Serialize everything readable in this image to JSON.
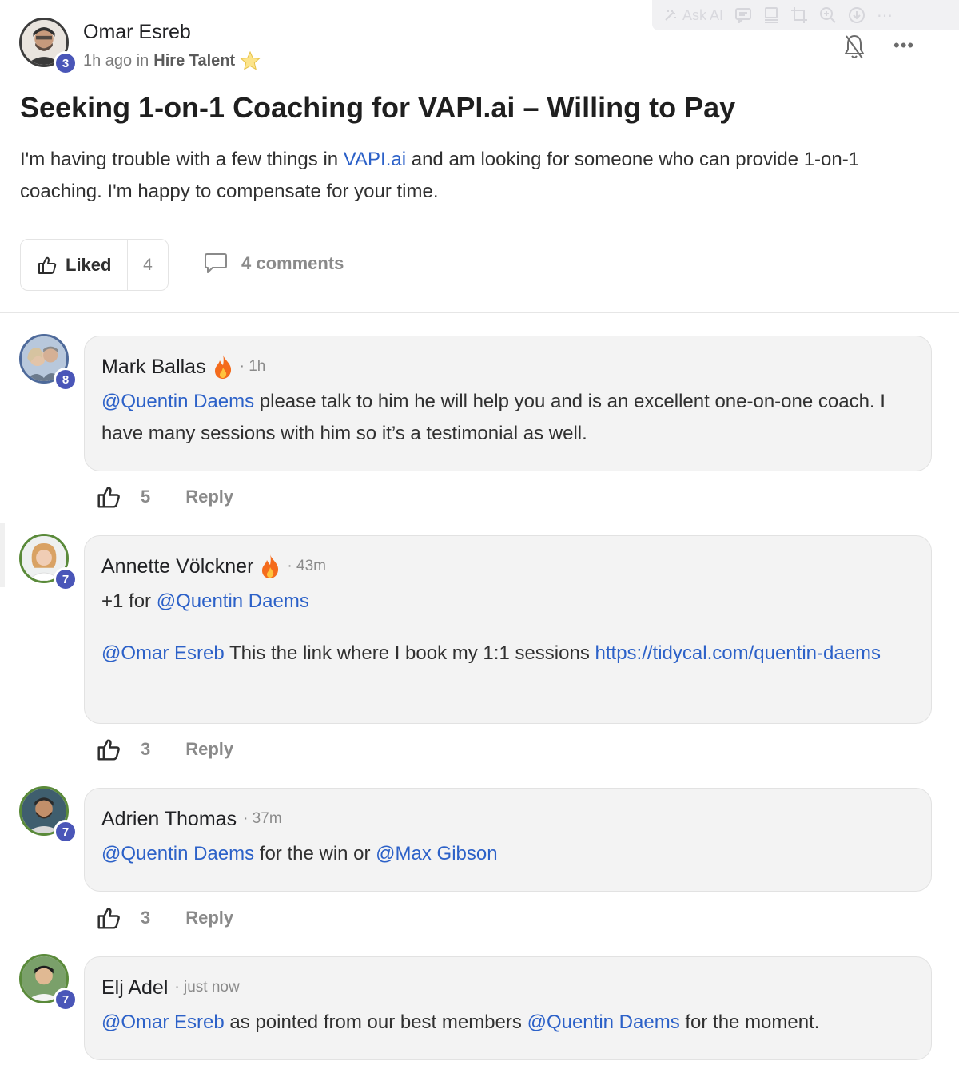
{
  "toolbar": {
    "ask_ai_label": "Ask AI",
    "icons": [
      "magic-wand-icon",
      "comment-icon",
      "presentation-icon",
      "crop-icon",
      "zoom-icon",
      "download-icon",
      "more-icon"
    ]
  },
  "post": {
    "author": "Omar Esreb",
    "author_level": "3",
    "time": "1h ago in",
    "group": "Hire Talent",
    "title": "Seeking 1-on-1 Coaching for VAPI.ai – Willing to Pay",
    "body_before": "I'm having trouble with a few things in ",
    "body_link": "VAPI.ai",
    "body_after": " and am looking for someone who can provide 1-on-1 coaching. I'm happy to compensate for your time.",
    "liked_label": "Liked",
    "like_count": "4",
    "comments_label": "4 comments",
    "more_label": "•••"
  },
  "comments": [
    {
      "author": "Mark Ballas",
      "level": "8",
      "time": "· 1h",
      "mention": "@Quentin Daems",
      "text": " please talk to him he will help you and is an excellent one-on-one coach. I have many sessions with him so it’s a testimonial as well.",
      "likes": "5",
      "reply": "Reply"
    },
    {
      "author": "Annette Völckner",
      "level": "7",
      "time": "· 43m",
      "line1_prefix": "+1 for ",
      "line1_mention": "@Quentin Daems",
      "line2_mention": "@Omar Esreb",
      "line2_text": " This the link where I book my 1:1 sessions ",
      "line2_link": "https://tidycal.com/quentin-daems",
      "likes": "3",
      "reply": "Reply"
    },
    {
      "author": "Adrien Thomas",
      "level": "7",
      "time": "· 37m",
      "mention1": "@Quentin Daems",
      "middle": " for the win or ",
      "mention2": "@Max Gibson",
      "likes": "3",
      "reply": "Reply"
    },
    {
      "author": "Elj Adel",
      "level": "7",
      "time": "· just now",
      "mention1": "@Omar Esreb",
      "middle": " as pointed from our best members ",
      "mention2": "@Quentin Daems",
      "after": " for the moment."
    }
  ]
}
